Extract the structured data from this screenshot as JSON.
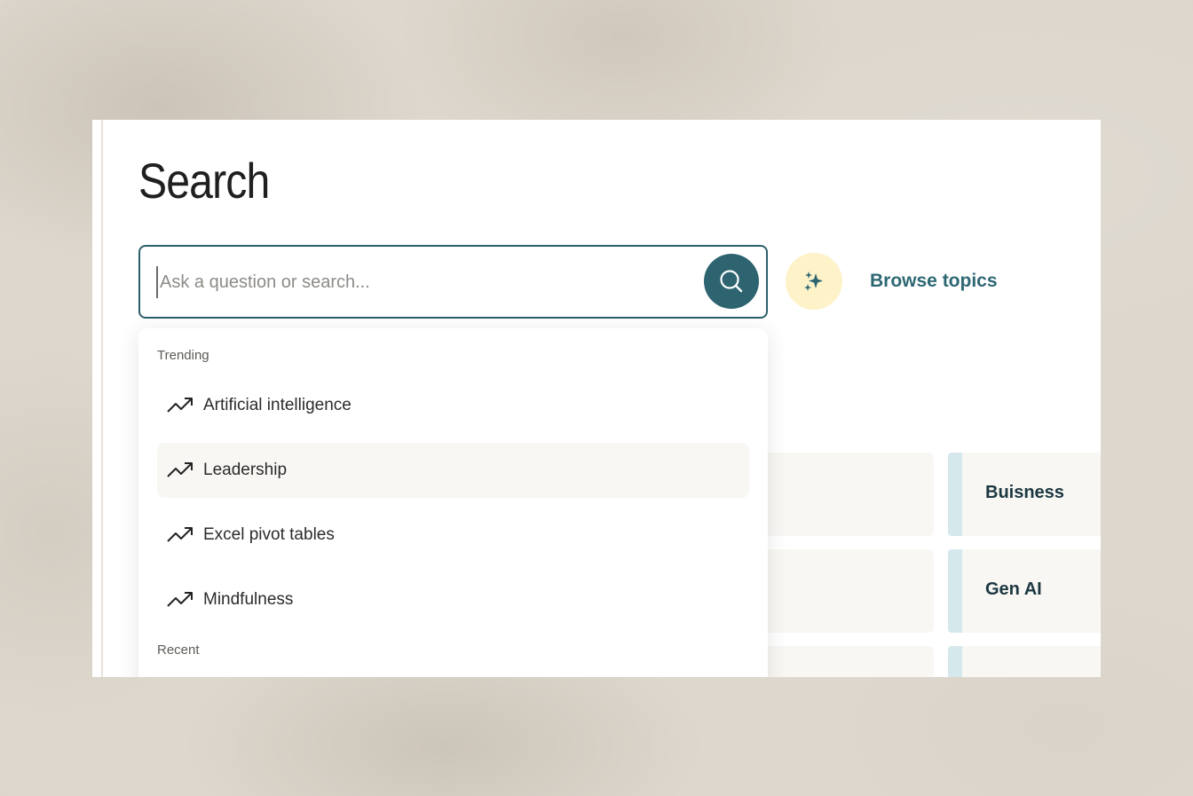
{
  "page": {
    "title": "Search"
  },
  "search": {
    "placeholder": "Ask a question or search...",
    "value": "",
    "submit_icon": "search-icon"
  },
  "ai_button": {
    "icon": "sparkles-icon"
  },
  "browse_topics_label": "Browse topics",
  "topic_cards": [
    {
      "label": "Buisness"
    },
    {
      "label": "Gen AI"
    },
    {
      "label": ""
    }
  ],
  "dropdown": {
    "trending_label": "Trending",
    "trending": [
      {
        "label": "Artificial intelligence",
        "icon": "trending-up-icon"
      },
      {
        "label": "Leadership",
        "icon": "trending-up-icon",
        "highlighted": true
      },
      {
        "label": "Excel pivot tables",
        "icon": "trending-up-icon"
      },
      {
        "label": "Mindfulness",
        "icon": "trending-up-icon"
      }
    ],
    "recent_label": "Recent"
  },
  "colors": {
    "accent": "#2d6470",
    "link": "#2e6874",
    "ai_button_bg": "#fdf2c8",
    "card_bg": "#f8f7f4",
    "topic_stripe": "#d5e8ec"
  }
}
